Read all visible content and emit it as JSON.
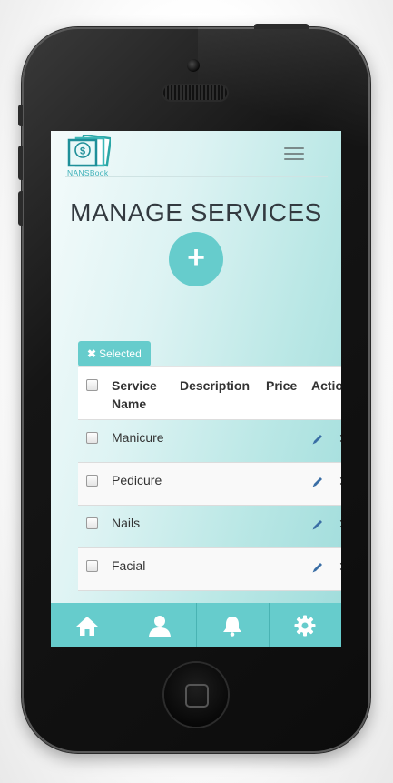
{
  "app": {
    "logo_text": "NANSBook"
  },
  "page": {
    "title": "MANAGE SERVICES"
  },
  "actions": {
    "add_label": "+",
    "delete_selected_label": "Selected"
  },
  "table": {
    "columns": [
      "Service\nName",
      "Description",
      "Price",
      "Actio"
    ],
    "rows": [
      {
        "name": "Manicure",
        "description": "",
        "price": ""
      },
      {
        "name": "Pedicure",
        "description": "",
        "price": ""
      },
      {
        "name": "Nails",
        "description": "",
        "price": ""
      },
      {
        "name": "Facial",
        "description": "",
        "price": ""
      }
    ]
  },
  "tabbar": {
    "items": [
      "home-icon",
      "user-icon",
      "bell-icon",
      "gear-icon"
    ]
  },
  "colors": {
    "accent": "#66cccc",
    "title": "#333a40",
    "edit_icon": "#3a6ea5"
  }
}
